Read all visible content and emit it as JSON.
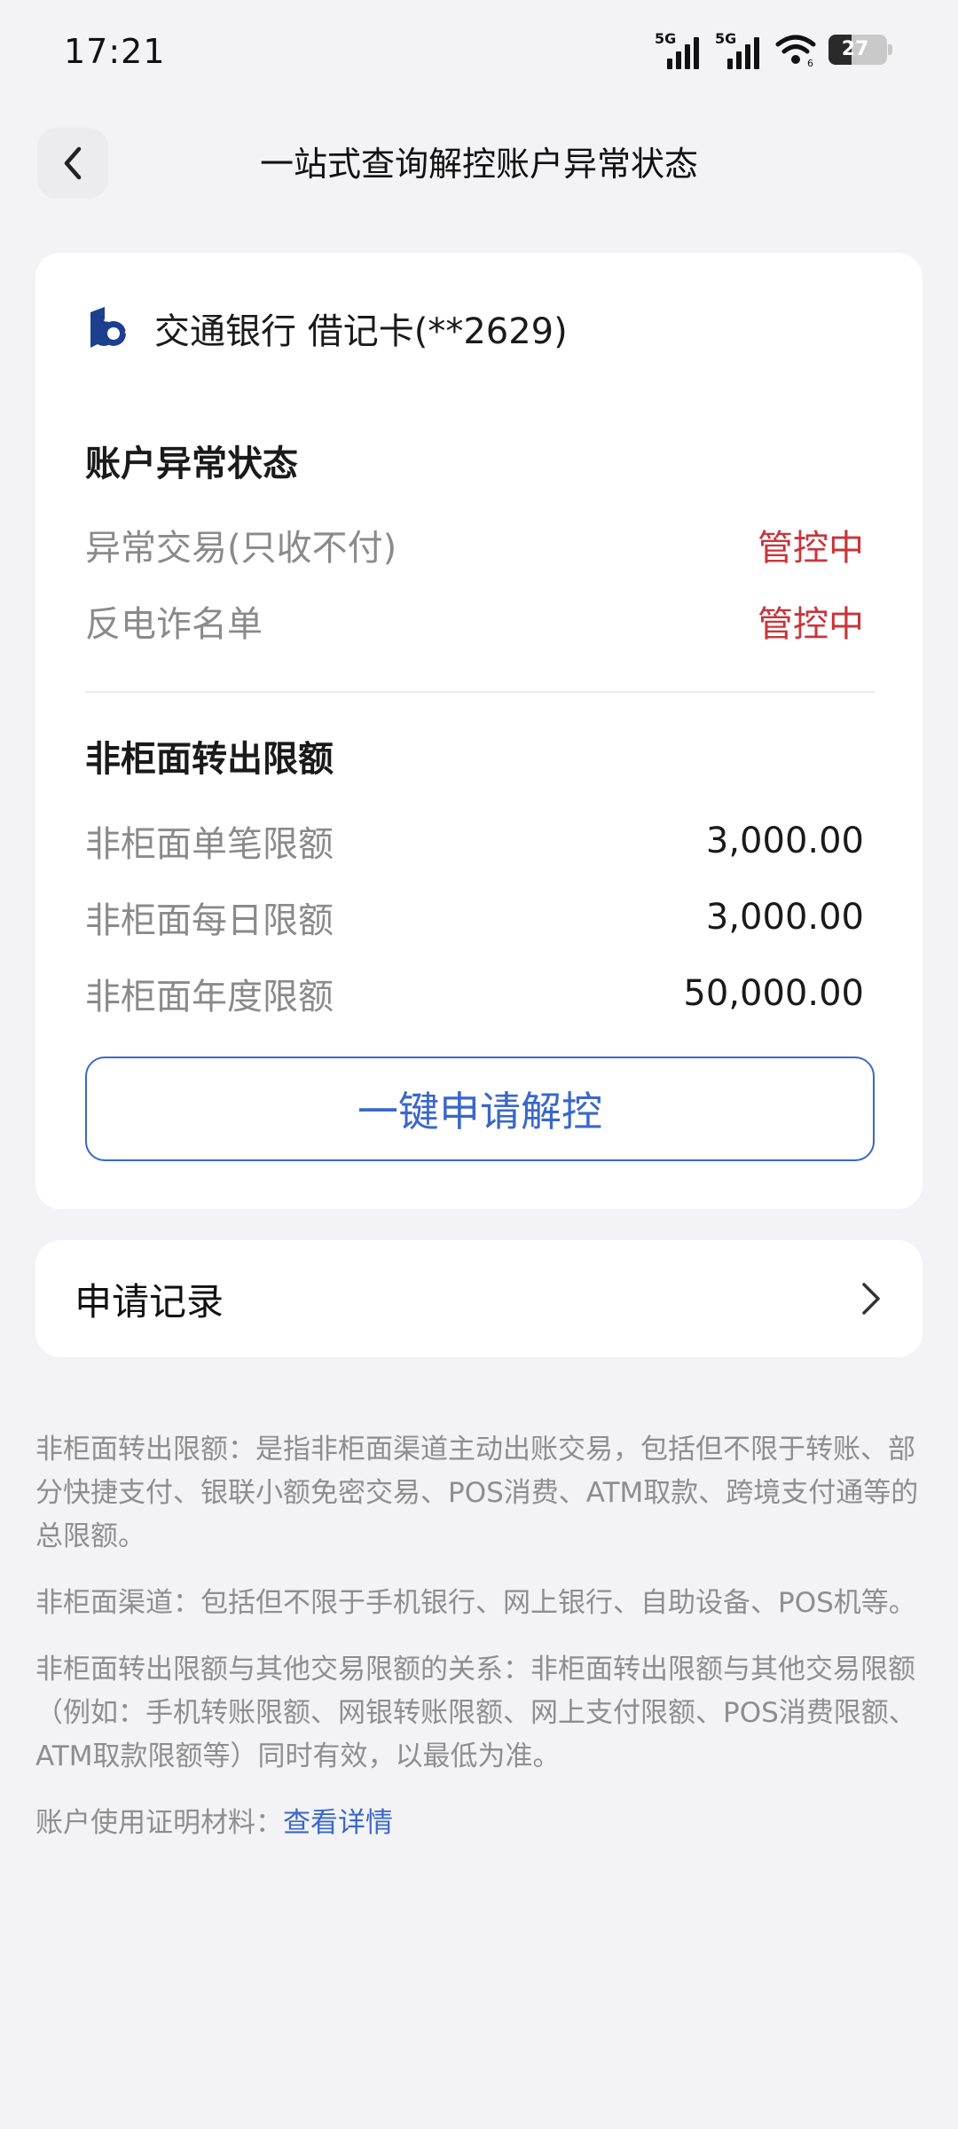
{
  "status_bar": {
    "time": "17:21",
    "signal1_label": "5G",
    "signal2_label": "5G",
    "wifi_badge": "6",
    "battery": "27"
  },
  "nav": {
    "title": "一站式查询解控账户异常状态"
  },
  "account": {
    "bank_name": "交通银行 借记卡(**2629)"
  },
  "abnormal_section": {
    "title": "账户异常状态",
    "rows": [
      {
        "label": "异常交易(只收不付)",
        "value": "管控中"
      },
      {
        "label": "反电诈名单",
        "value": "管控中"
      }
    ]
  },
  "limit_section": {
    "title": "非柜面转出限额",
    "rows": [
      {
        "label": "非柜面单笔限额",
        "value": "3,000.00"
      },
      {
        "label": "非柜面每日限额",
        "value": "3,000.00"
      },
      {
        "label": "非柜面年度限额",
        "value": "50,000.00"
      }
    ]
  },
  "unlock_button": "一键申请解控",
  "record": {
    "label": "申请记录"
  },
  "notes": {
    "n1": "非柜面转出限额：是指非柜面渠道主动出账交易，包括但不限于转账、部分快捷支付、银联小额免密交易、POS消费、ATM取款、跨境支付通等的总限额。",
    "n2": "非柜面渠道：包括但不限于手机银行、网上银行、自助设备、POS机等。",
    "n3": "非柜面转出限额与其他交易限额的关系：非柜面转出限额与其他交易限额（例如：手机转账限额、网银转账限额、网上支付限额、POS消费限额、ATM取款限额等）同时有效，以最低为准。",
    "n4_prefix": "账户使用证明材料：",
    "n4_link": "查看详情"
  },
  "colors": {
    "accent": "#3a67c9",
    "alert": "#c8353b",
    "background": "#f3f3f5"
  }
}
